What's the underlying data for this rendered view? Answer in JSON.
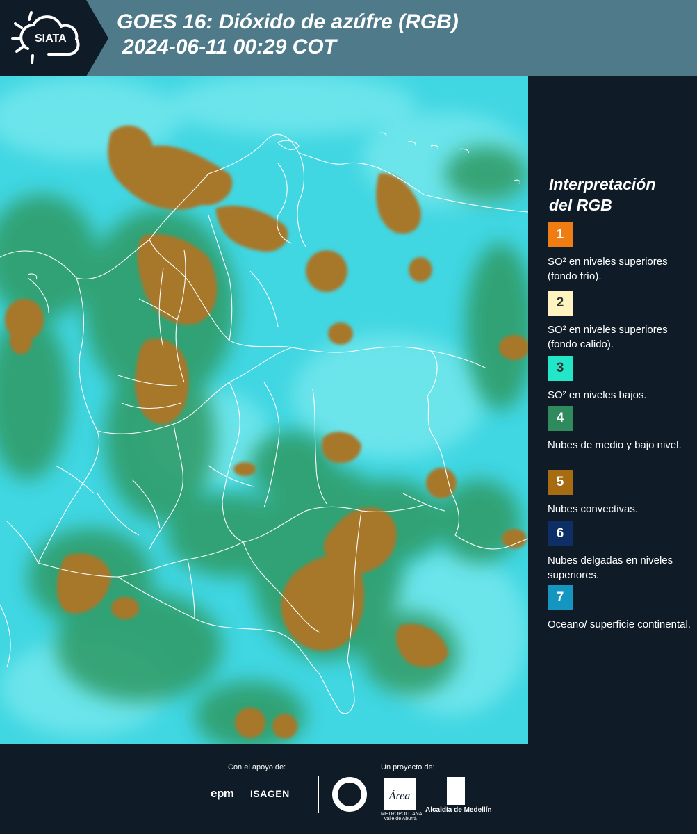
{
  "header": {
    "logo_text": "SIATA",
    "title_line1": "GOES 16: Dióxido de azúfre (RGB)",
    "title_line2": "2024-06-11 00:29 COT"
  },
  "legend": {
    "title_line1": "Interpretación",
    "title_line2": "del RGB",
    "items": [
      {
        "number": "1",
        "color": "#f07d12",
        "text": "SO² en niveles superiores (fondo frío)."
      },
      {
        "number": "2",
        "color": "#fff3c0",
        "text": "SO² en niveles superiores (fondo calido)."
      },
      {
        "number": "3",
        "color": "#22e6c8",
        "text": "SO² en niveles bajos."
      },
      {
        "number": "4",
        "color": "#2f8a5e",
        "text": "Nubes de medio y bajo nivel."
      },
      {
        "number": "5",
        "color": "#a76c12",
        "text": "Nubes convectivas."
      },
      {
        "number": "6",
        "color": "#0d2f66",
        "text": "Nubes delgadas en niveles superiores."
      },
      {
        "number": "7",
        "color": "#1596c0",
        "text": "Oceano/ superficie continental."
      }
    ]
  },
  "map": {
    "colors": {
      "background": "#3fd8e4",
      "low_clouds": "#35a86a",
      "convective": "#a8782c",
      "borders": "#ffffff"
    }
  },
  "footer": {
    "support_label": "Con el apoyo de:",
    "project_label": "Un proyecto de:",
    "sponsor1": "epm",
    "sponsor2": "ISAGEN",
    "partner_area": "Área",
    "partner_area_sub": "METROPOLITANA Valle de Aburrá",
    "partner_alcaldia": "Alcaldía de Medellín"
  }
}
